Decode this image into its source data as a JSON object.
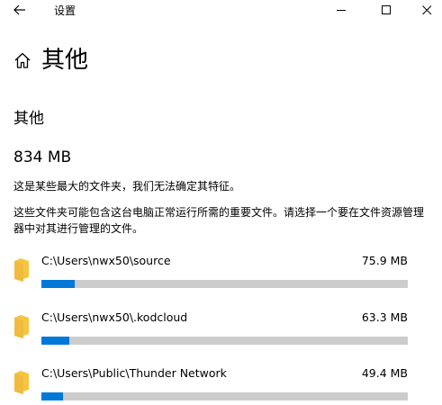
{
  "titlebar": {
    "title": "设置",
    "back_icon": "arrow-left-icon",
    "minimize_icon": "minimize-icon",
    "maximize_icon": "maximize-icon",
    "close_icon": "close-icon"
  },
  "header": {
    "home_icon": "home-icon",
    "title": "其他"
  },
  "section": {
    "title": "其他",
    "total_size": "834 MB",
    "description_1": "这是某些最大的文件夹，我们无法确定其特征。",
    "description_2": "这些文件夹可能包含这台电脑正常运行所需的重要文件。请选择一个要在文件资源管理器中对其进行管理的文件。"
  },
  "folders": [
    {
      "path": "C:\\Users\\nwx50\\source",
      "size": "75.9 MB",
      "fill_fraction": 0.09
    },
    {
      "path": "C:\\Users\\nwx50\\.kodcloud",
      "size": "63.3 MB",
      "fill_fraction": 0.075
    },
    {
      "path": "C:\\Users\\Public\\Thunder Network",
      "size": "49.4 MB",
      "fill_fraction": 0.058
    }
  ],
  "colors": {
    "accent": "#0078d7",
    "track": "#cccccc",
    "folder": "#f5c542"
  }
}
